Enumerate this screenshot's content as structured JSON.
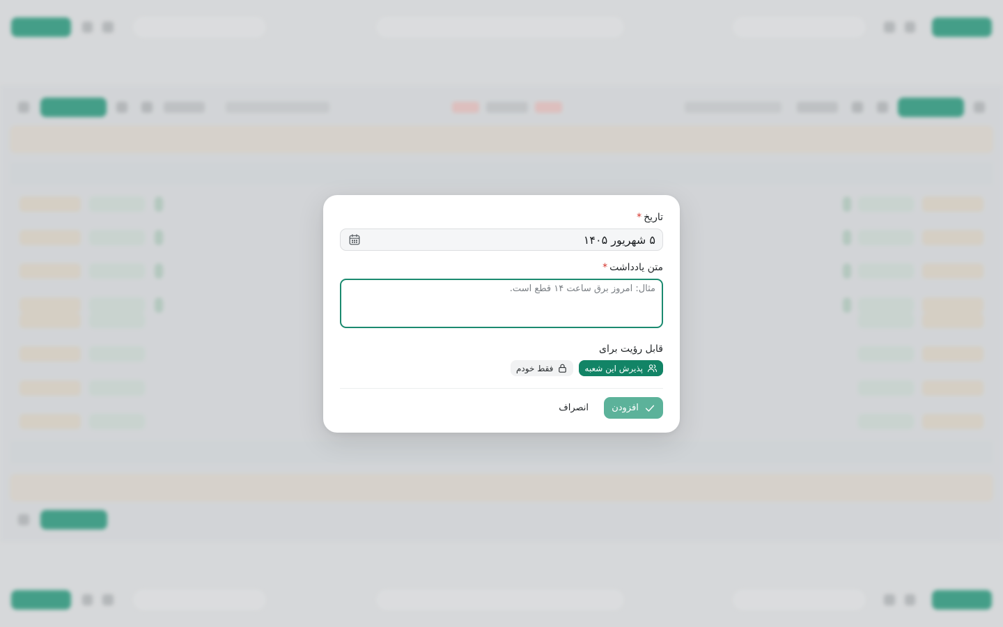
{
  "modal": {
    "date_label": "تاریخ",
    "date_value": "۵ شهریور ۱۴۰۵",
    "note_label": "متن یادداشت",
    "note_placeholder": "مثال: امروز برق ساعت ۱۴ قطع است.",
    "note_value": "",
    "required_mark": "*",
    "visibility_label": "قابل رؤیت برای",
    "visibility_options": [
      {
        "label": "پذیرش این شعبه",
        "icon": "users-icon",
        "selected": true
      },
      {
        "label": "فقط خودم",
        "icon": "lock-icon",
        "selected": false
      }
    ],
    "add_label": "افزودن",
    "cancel_label": "انصراف"
  },
  "colors": {
    "primary": "#128466",
    "primary_disabled": "#5cb29a",
    "required": "#d4342c",
    "backdrop": "#d9dadb"
  }
}
